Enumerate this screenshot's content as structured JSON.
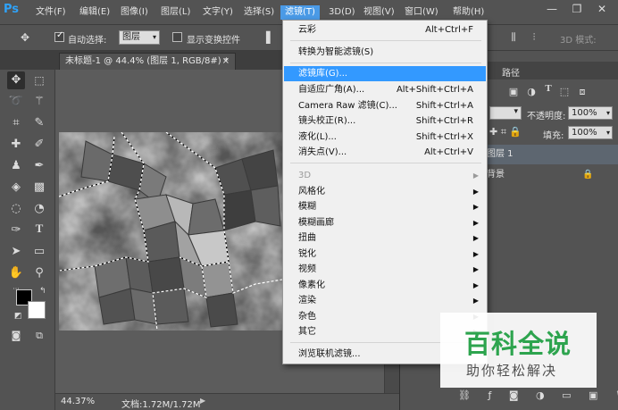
{
  "app": {
    "logo": "Ps"
  },
  "menubar": {
    "items": [
      "文件(F)",
      "编辑(E)",
      "图像(I)",
      "图层(L)",
      "文字(Y)",
      "选择(S)",
      "滤镜(T)",
      "3D(D)",
      "视图(V)",
      "窗口(W)",
      "帮助(H)"
    ],
    "active": "滤镜(T)"
  },
  "window_controls": {
    "minimize": "—",
    "restore": "❐",
    "close": "✕"
  },
  "options": {
    "auto_select_label": "自动选择:",
    "auto_select_checked": true,
    "auto_select_value": "图层",
    "show_transform_label": "显示变换控件",
    "show_transform_checked": false,
    "mode_3d_label": "3D 模式:"
  },
  "document": {
    "tab_title": "未标题-1 @ 44.4% (图层 1, RGB/8#) *",
    "tab_close": "×",
    "zoom": "44.37%",
    "doc_size": "文档:1.72M/1.72M"
  },
  "filter_menu": {
    "items": [
      {
        "label": "云彩",
        "shortcut": "Alt+Ctrl+F"
      },
      {
        "label": "转换为智能滤镜(S)",
        "shortcut": ""
      },
      {
        "label": "滤镜库(G)...",
        "shortcut": "",
        "highlighted": true
      },
      {
        "label": "自适应广角(A)...",
        "shortcut": "Alt+Shift+Ctrl+A"
      },
      {
        "label": "Camera Raw 滤镜(C)...",
        "shortcut": "Shift+Ctrl+A"
      },
      {
        "label": "镜头校正(R)...",
        "shortcut": "Shift+Ctrl+R"
      },
      {
        "label": "液化(L)...",
        "shortcut": "Shift+Ctrl+X"
      },
      {
        "label": "消失点(V)...",
        "shortcut": "Alt+Ctrl+V"
      },
      {
        "label": "3D",
        "disabled": true,
        "submenu": true
      },
      {
        "label": "风格化",
        "submenu": true
      },
      {
        "label": "模糊",
        "submenu": true
      },
      {
        "label": "模糊画廊",
        "submenu": true
      },
      {
        "label": "扭曲",
        "submenu": true
      },
      {
        "label": "锐化",
        "submenu": true
      },
      {
        "label": "视频",
        "submenu": true
      },
      {
        "label": "像素化",
        "submenu": true
      },
      {
        "label": "渲染",
        "submenu": true
      },
      {
        "label": "杂色",
        "submenu": true
      },
      {
        "label": "其它",
        "submenu": true
      },
      {
        "label": "浏览联机滤镜...",
        "shortcut": ""
      }
    ]
  },
  "panel": {
    "paths_tab": "路径",
    "opacity_label": "不透明度:",
    "opacity_value": "100%",
    "fill_label": "填充:",
    "fill_value": "100%",
    "layers": [
      {
        "name": "图层 1",
        "selected": true
      },
      {
        "name": "背景",
        "locked": true
      }
    ]
  },
  "watermark": {
    "title": "百科全说",
    "subtitle": "助你轻松解决"
  },
  "colors": {
    "accent": "#3399ff",
    "menu_active": "#4a9ae6",
    "ps_blue": "#2fa2f8",
    "watermark_green": "#2da44e"
  }
}
